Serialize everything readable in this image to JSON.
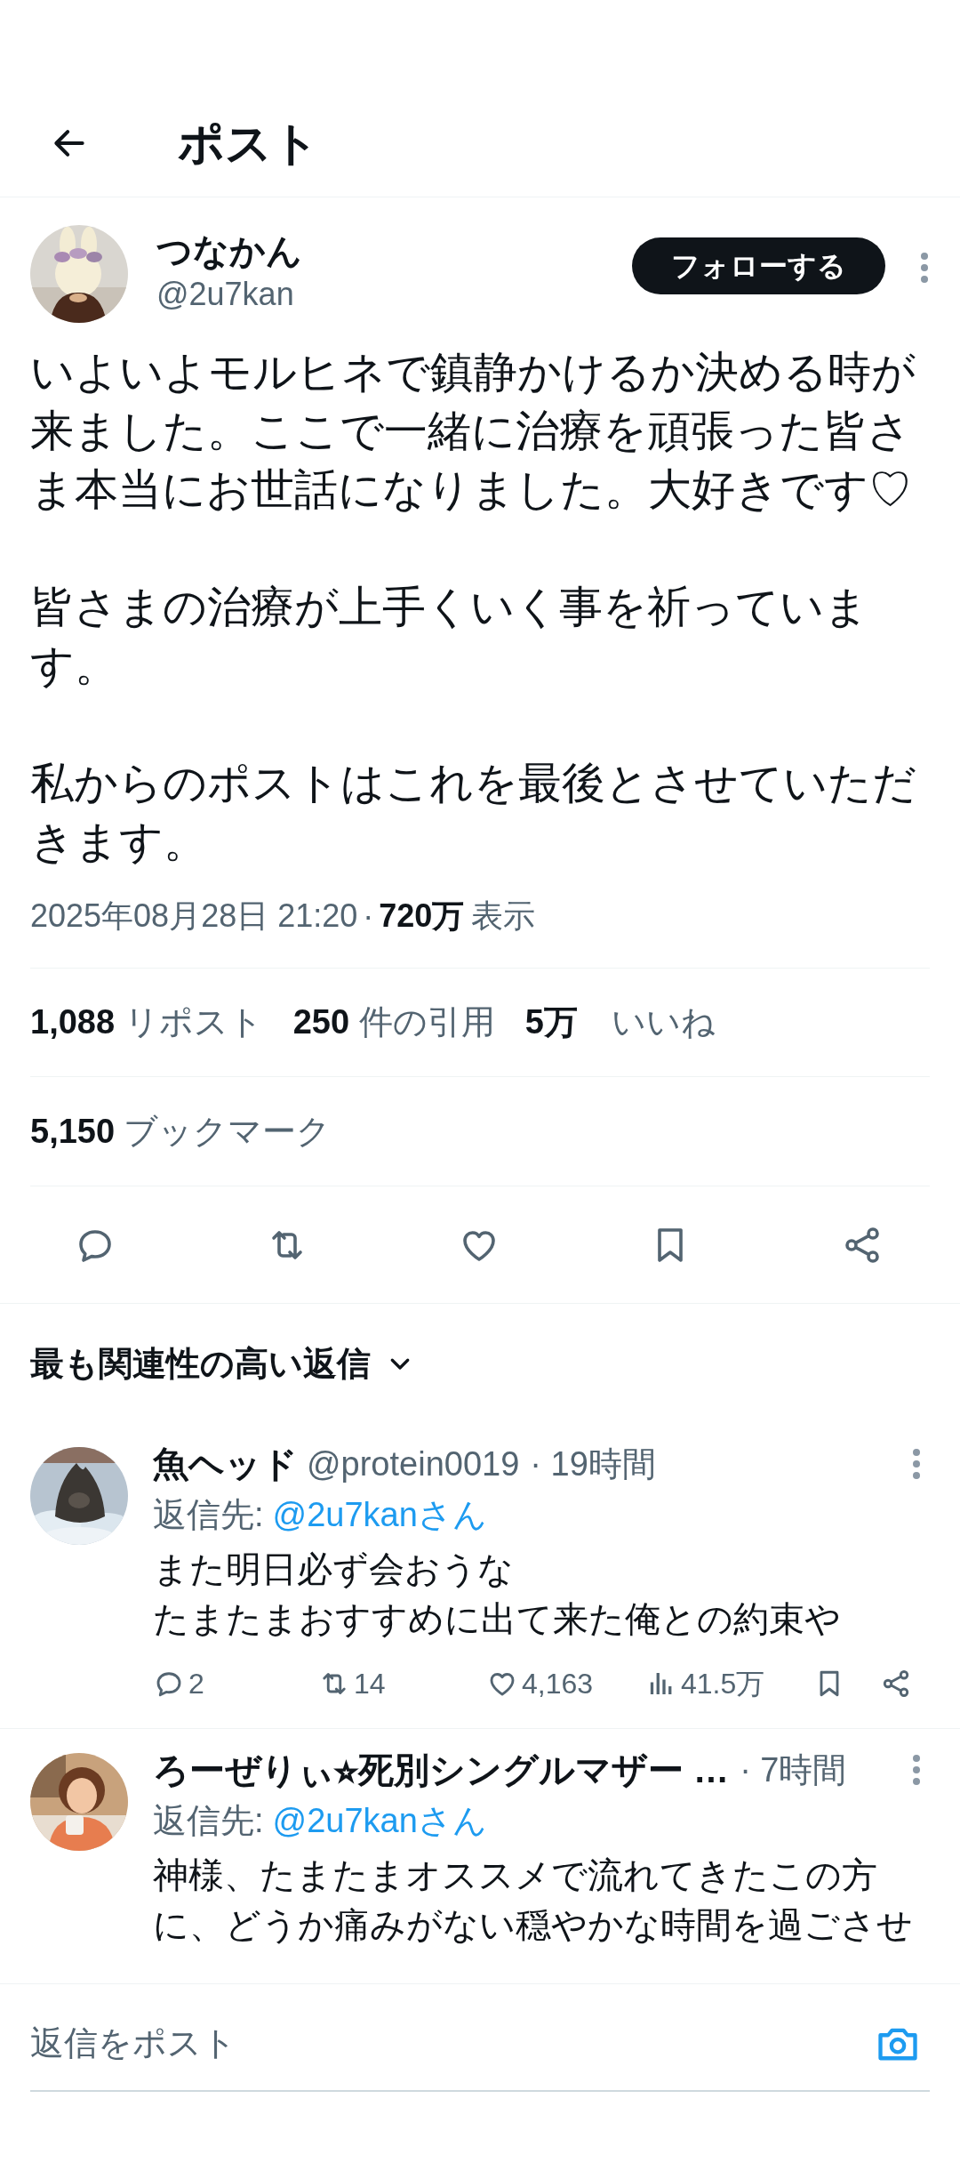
{
  "header": {
    "title": "ポスト"
  },
  "post": {
    "author": {
      "name": "つなかん",
      "handle": "@2u7kan"
    },
    "follow_button": "フォローする",
    "paragraphs": [
      "いよいよモルヒネで鎮静かけるか決める時が来ました。ここで一緒に治療を頑張った皆さま本当にお世話になりました。大好きです♡",
      "皆さまの治療が上手くいく事を祈っています。",
      "私からのポストはこれを最後とさせていただきます。"
    ],
    "timestamp": "2025年08月28日 21:20",
    "separator": "·",
    "views": "720万",
    "views_label": "表示",
    "stats": [
      "**1,088** リポスト",
      "**250** 件の引用",
      "**5万**　いいね"
    ],
    "bookmarks": {
      "value": "5,150",
      "label": "ブックマーク"
    }
  },
  "replies_sort": {
    "label": "最も関連性の高い返信"
  },
  "replies": [
    {
      "name": "魚ヘッド",
      "handle": "@protein0019",
      "time": "· 19時間",
      "reply_to_label": "返信先:",
      "reply_to": "@2u7kanさん",
      "lines": [
        "また明日必ず会おうな",
        "たまたまおすすめに出て来た俺との約束や"
      ],
      "counts": {
        "replies": "2",
        "reposts": "14",
        "likes": "4,163",
        "views": "41.5万"
      }
    },
    {
      "name": "ろーぜりぃ⭐︎死別シングルマザー …",
      "time": "· 7時間",
      "reply_to_label": "返信先:",
      "reply_to": "@2u7kanさん",
      "lines": [
        "神様、たまたまオススメで流れてきたこの方に、どうか痛みがない穏やかな時間を過ごさせ"
      ]
    }
  ],
  "composer": {
    "placeholder": "返信をポスト"
  }
}
